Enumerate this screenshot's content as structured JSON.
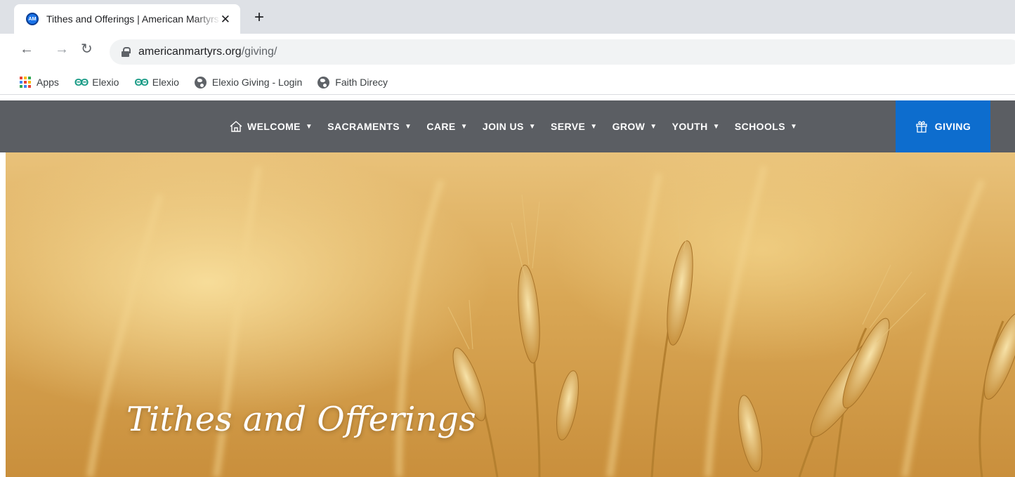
{
  "browser": {
    "tab": {
      "favicon_text": "AM",
      "title": "Tithes and Offerings | American Martyrs"
    },
    "address": {
      "domain": "americanmartyrs.org",
      "path": "/giving/"
    },
    "bookmarks": [
      {
        "label": "Apps",
        "icon": "apps-grid-icon"
      },
      {
        "label": "Elexio",
        "icon": "elexio-icon"
      },
      {
        "label": "Elexio",
        "icon": "elexio-icon"
      },
      {
        "label": "Elexio Giving - Login",
        "icon": "globe-icon"
      },
      {
        "label": "Faith Direcy",
        "icon": "globe-icon"
      }
    ]
  },
  "site_nav": {
    "items": [
      {
        "label": "WELCOME"
      },
      {
        "label": "SACRAMENTS"
      },
      {
        "label": "CARE"
      },
      {
        "label": "JOIN US"
      },
      {
        "label": "SERVE"
      },
      {
        "label": "GROW"
      },
      {
        "label": "YOUTH"
      },
      {
        "label": "SCHOOLS"
      }
    ],
    "giving_label": "GIVING",
    "colors": {
      "bar": "#5b5e63",
      "giving": "#0d6dce"
    }
  },
  "hero": {
    "title": "Tithes and Offerings"
  }
}
